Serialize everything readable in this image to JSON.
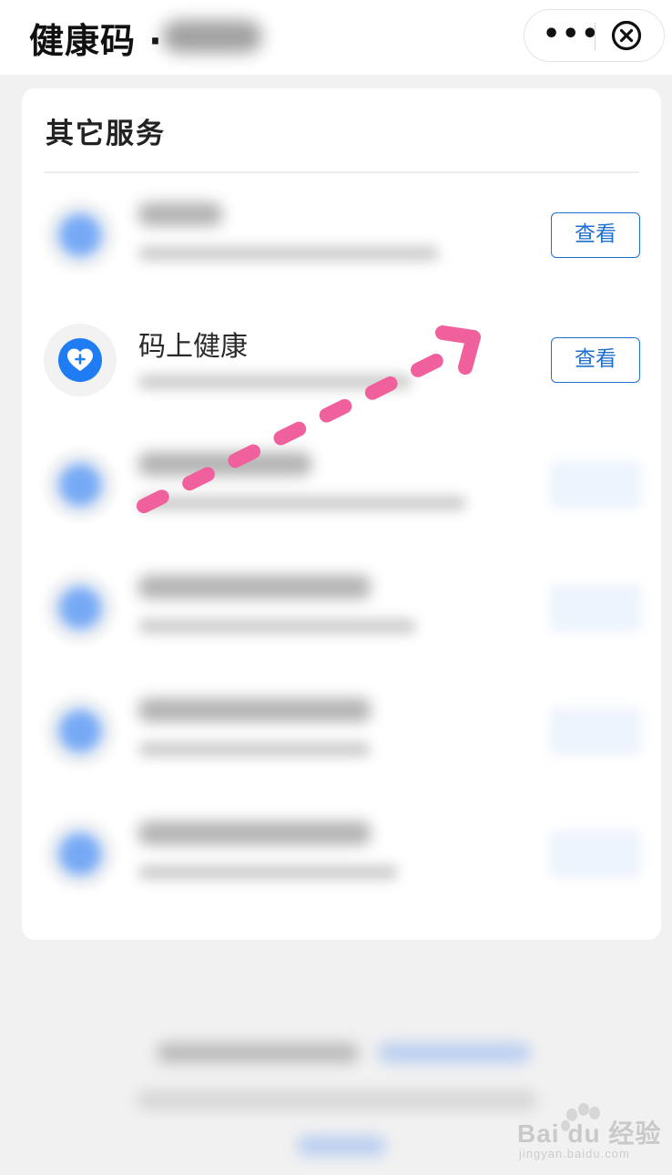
{
  "header": {
    "title": "健康码 ·",
    "more_icon": "more-dots-icon",
    "close_icon": "close-circle-icon"
  },
  "card": {
    "section_title": "其它服务",
    "view_label": "查看",
    "visible_item": {
      "name": "码上健康",
      "icon": "heart-plus-icon"
    }
  },
  "watermark": {
    "brand": "Bai du 经验",
    "sub": "jingyan.baidu.com"
  },
  "colors": {
    "accent": "#1f6fcf",
    "icon_blue": "#1f7cf2",
    "annotation_pink": "#f0609c"
  }
}
